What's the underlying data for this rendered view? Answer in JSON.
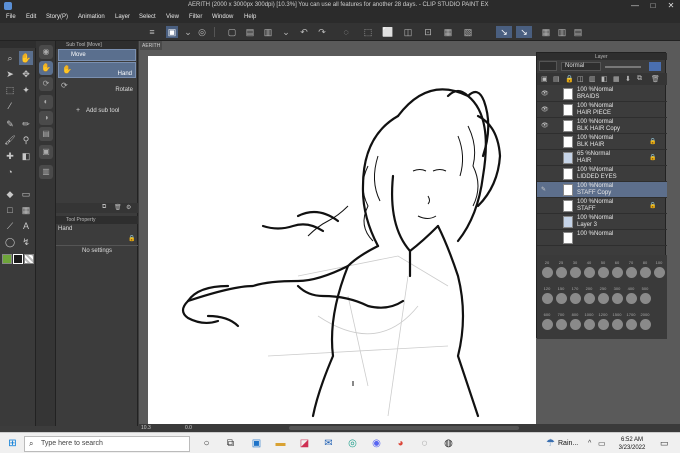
{
  "window": {
    "title": "AERITH (2000 x 3000px 300dpi) [10.3%]  You can use all features for another 28 days. - CLIP STUDIO PAINT EX",
    "minimize": "—",
    "maximize": "□",
    "close": "✕"
  },
  "menu": [
    "File",
    "Edit",
    "Story(P)",
    "Animation",
    "Layer",
    "Select",
    "View",
    "Filter",
    "Window",
    "Help"
  ],
  "subtool_panel": {
    "header": "Sub Tool [Move]",
    "items": [
      {
        "label": "Move",
        "selected": true
      },
      {
        "label": "Hand",
        "selected": false
      },
      {
        "label": "Rotate",
        "selected": false
      }
    ],
    "add_label": "Add sub tool"
  },
  "tool_property": {
    "header": "Tool Property",
    "tool_name": "Hand",
    "empty_text": "No settings"
  },
  "canvas": {
    "tab_label": "AERITH",
    "zoom": "10.3",
    "angle": "0.0"
  },
  "layer_panel": {
    "title": "Layer",
    "blend_mode": "Normal",
    "layers": [
      {
        "opacity": "100 %Normal",
        "name": "BRAIDS",
        "visible": true,
        "locked": false,
        "selected": false
      },
      {
        "opacity": "100 %Normal",
        "name": "HAIR PIECE",
        "visible": true,
        "locked": false,
        "selected": false
      },
      {
        "opacity": "100 %Normal",
        "name": "BLK HAIR Copy",
        "visible": true,
        "locked": false,
        "selected": false
      },
      {
        "opacity": "100 %Normal",
        "name": "BLK HAIR",
        "visible": false,
        "locked": true,
        "selected": false
      },
      {
        "opacity": "65 %Normal",
        "name": "HAIR",
        "visible": false,
        "locked": true,
        "selected": false
      },
      {
        "opacity": "100 %Normal",
        "name": "LIDDED EYES",
        "visible": false,
        "locked": false,
        "selected": false
      },
      {
        "opacity": "100 %Normal",
        "name": "STAFF Copy",
        "visible": false,
        "locked": false,
        "selected": true
      },
      {
        "opacity": "100 %Normal",
        "name": "STAFF",
        "visible": false,
        "locked": true,
        "selected": false
      },
      {
        "opacity": "100 %Normal",
        "name": "Layer 3",
        "visible": false,
        "locked": false,
        "selected": false
      },
      {
        "opacity": "100 %Normal",
        "name": "",
        "visible": false,
        "locked": false,
        "selected": false
      }
    ],
    "brush_sizes_row1": [
      "20",
      "25",
      "30",
      "40",
      "50",
      "60",
      "70",
      "80",
      "100"
    ],
    "brush_sizes_row2": [
      "120",
      "150",
      "170",
      "200",
      "250",
      "300",
      "400",
      "500"
    ],
    "brush_sizes_row3": [
      "600",
      "700",
      "800",
      "1000",
      "1200",
      "1500",
      "1700",
      "2000"
    ]
  },
  "colors": {
    "main": "#1a1a1a",
    "sub": "#ffffff",
    "accent_green": "#6ea53a",
    "selection": "#5d6f8c"
  },
  "taskbar": {
    "search_placeholder": "Type here to search",
    "weather": "Rain...",
    "time": "6:52 AM",
    "date": "3/23/2022"
  }
}
